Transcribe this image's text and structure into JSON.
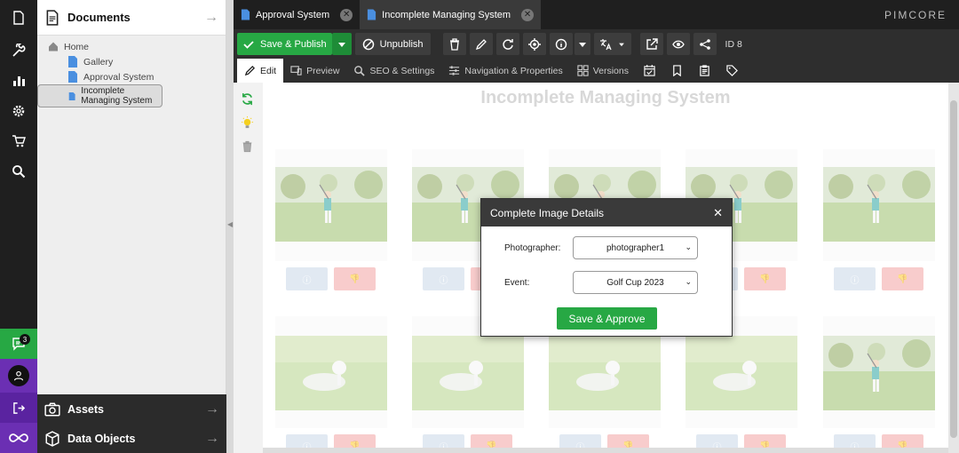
{
  "tree": {
    "header_title": "Documents",
    "items": [
      {
        "label": "Home"
      },
      {
        "label": "Gallery"
      },
      {
        "label": "Approval System"
      },
      {
        "label": "Incomplete Managing System"
      }
    ],
    "assets_label": "Assets",
    "data_objects_label": "Data Objects"
  },
  "rail": {
    "notification_count": "3"
  },
  "tabs": [
    {
      "label": "Approval System"
    },
    {
      "label": "Incomplete Managing System"
    }
  ],
  "brand": "PIMCORE",
  "toolbar": {
    "save_publish_label": "Save & Publish",
    "unpublish_label": "Unpublish",
    "id_label": "ID 8"
  },
  "subtabs": {
    "edit": "Edit",
    "preview": "Preview",
    "seo": "SEO & Settings",
    "navigation": "Navigation & Properties",
    "versions": "Versions"
  },
  "page": {
    "title": "Incomplete Managing System"
  },
  "modal": {
    "title": "Complete Image Details",
    "photographer_label": "Photographer:",
    "photographer_value": "photographer1",
    "event_label": "Event:",
    "event_value": "Golf Cup 2023",
    "approve_label": "Save & Approve"
  },
  "colors": {
    "accent_green": "#27a844",
    "purple": "#6b2fb3",
    "dark": "#1f1f1f",
    "reject_red": "#f2a3a3",
    "info_blue": "#c8d8e8"
  }
}
